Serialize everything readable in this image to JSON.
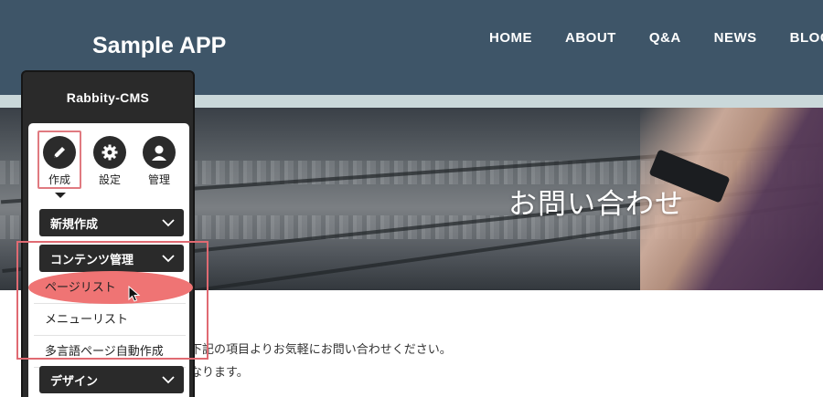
{
  "site": {
    "title": "Sample APP",
    "nav": [
      "HOME",
      "ABOUT",
      "Q&A",
      "NEWS",
      "BLOG"
    ],
    "hero_title": "お問い合わせ",
    "body_lines": [
      "下記の項目よりお気軽にお問い合わせください。",
      "なります。"
    ]
  },
  "cms": {
    "logo": "Rabbity-CMS",
    "tools": [
      {
        "label": "作成",
        "icon": "pen-icon",
        "selected": true
      },
      {
        "label": "設定",
        "icon": "gear-icon",
        "selected": false
      },
      {
        "label": "管理",
        "icon": "user-icon",
        "selected": false
      }
    ],
    "categories": {
      "new": "新規作成",
      "contents": "コンテンツ管理",
      "design": "デザイン"
    },
    "content_items": [
      "ページリスト",
      "メニューリスト",
      "多言語ページ自動作成"
    ]
  },
  "colors": {
    "header_bg": "#3e5568",
    "highlight": "#ef7474",
    "frame": "#e06a72",
    "panel_bg": "#2a2a2a"
  }
}
